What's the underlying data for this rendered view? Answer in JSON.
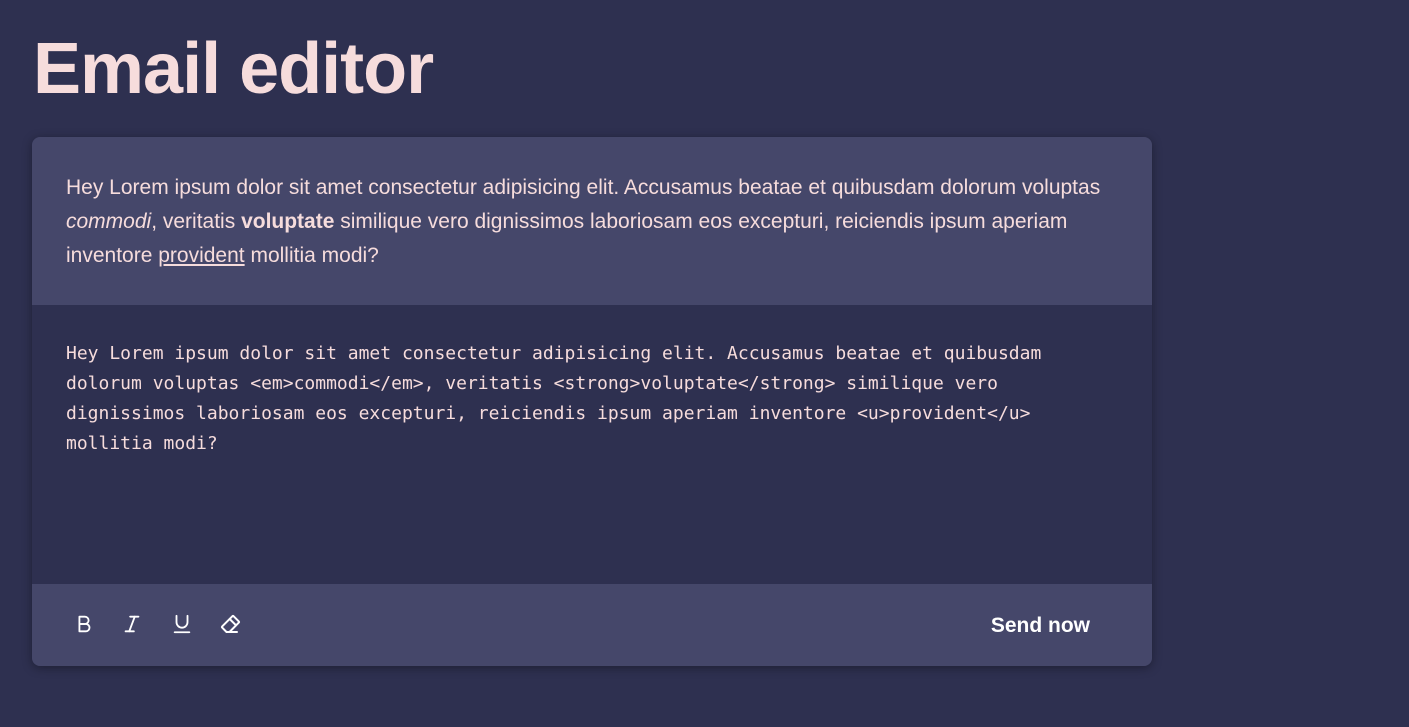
{
  "page": {
    "title": "Email editor"
  },
  "preview": {
    "seg1": "Hey Lorem ipsum dolor sit amet consectetur adipisicing elit. Accusamus beatae et quibusdam dolorum voluptas ",
    "em": "commodi",
    "seg2": ", veritatis ",
    "strong": "voluptate",
    "seg3": " similique vero dignissimos laboriosam eos excepturi, reiciendis ipsum aperiam inventore ",
    "u": "provident",
    "seg4": " mollitia modi?"
  },
  "source": {
    "value": "Hey Lorem ipsum dolor sit amet consectetur adipisicing elit. Accusamus beatae et quibusdam dolorum voluptas <em>commodi</em>, veritatis <strong>voluptate</strong> similique vero dignissimos laboriosam eos excepturi, reiciendis ipsum aperiam inventore <u>provident</u> mollitia modi?"
  },
  "toolbar": {
    "tools": [
      {
        "name": "bold-icon"
      },
      {
        "name": "italic-icon"
      },
      {
        "name": "underline-icon"
      },
      {
        "name": "eraser-icon"
      }
    ],
    "send_label": "Send now"
  },
  "colors": {
    "background": "#2e3050",
    "panel": "#45476a",
    "text": "#f6dcdc",
    "button_text": "#ffffff"
  }
}
